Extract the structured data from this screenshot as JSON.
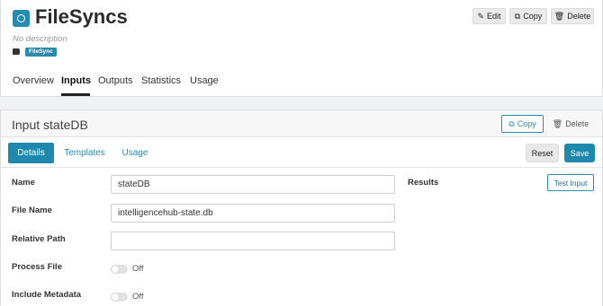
{
  "app": {
    "title": "FileSyncs",
    "description": "No description",
    "tag": "FileSync",
    "actions": {
      "edit": "Edit",
      "copy": "Copy",
      "delete": "Delete"
    }
  },
  "main_tabs": [
    "Overview",
    "Inputs",
    "Outputs",
    "Statistics",
    "Usage"
  ],
  "active_main_tab": "Inputs",
  "input_panel": {
    "title": "Input stateDB",
    "copy_label": "Copy",
    "delete_label": "Delete",
    "subtabs": [
      "Details",
      "Templates",
      "Usage"
    ],
    "active_subtab": "Details",
    "reset_label": "Reset",
    "save_label": "Save"
  },
  "form": {
    "name": {
      "label": "Name",
      "value": "stateDB"
    },
    "file_name": {
      "label": "File Name",
      "value": "intelligencehub-state.db"
    },
    "relative_path": {
      "label": "Relative Path",
      "value": ""
    },
    "process_file": {
      "label": "Process File",
      "state": "Off"
    },
    "include_metadata": {
      "label": "Include Metadata",
      "state": "Off"
    }
  },
  "results": {
    "label": "Results",
    "test_button": "Test Input"
  }
}
